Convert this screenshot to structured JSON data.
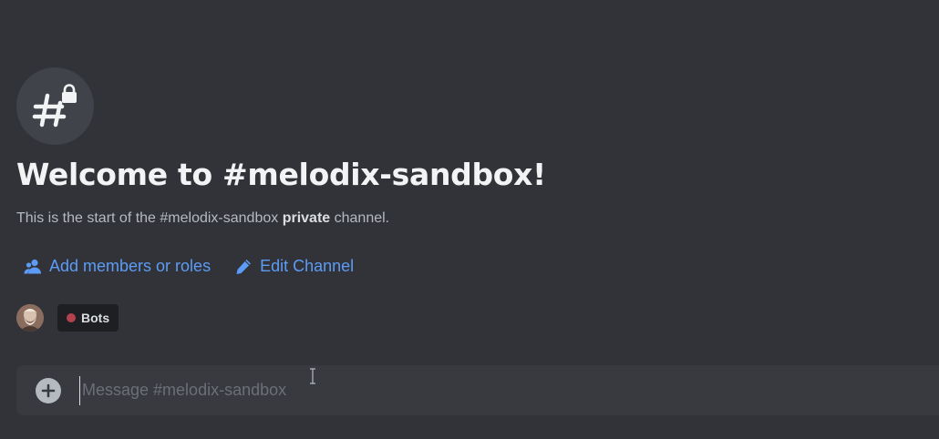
{
  "welcome": {
    "title": "Welcome to #melodix-sandbox!",
    "subtitle_prefix": "This is the start of the #melodix-sandbox ",
    "subtitle_emphasis": "private",
    "subtitle_suffix": " channel."
  },
  "channel_icon": "hashtag-lock-icon",
  "actions": {
    "add_members": {
      "label": "Add members or roles",
      "icon": "people-icon"
    },
    "edit_channel": {
      "label": "Edit Channel",
      "icon": "pencil-icon"
    }
  },
  "members": {
    "avatar": "user-avatar",
    "role": {
      "label": "Bots",
      "color": "#b3414e"
    }
  },
  "composer": {
    "placeholder": "Message #melodix-sandbox",
    "attach_icon": "plus-circle-icon"
  },
  "colors": {
    "background": "#313338",
    "link": "#5c9cf6",
    "composer": "#383a40"
  }
}
